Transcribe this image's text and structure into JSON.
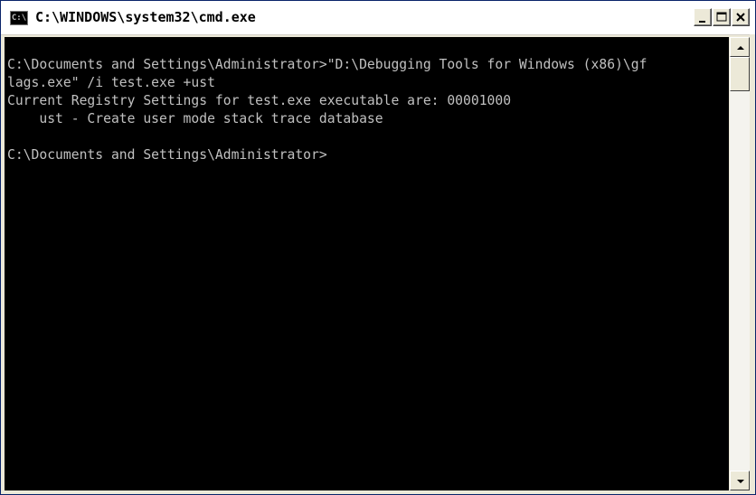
{
  "window": {
    "title": "C:\\WINDOWS\\system32\\cmd.exe",
    "icon_label": "C:\\",
    "icon_name": "cmd-icon"
  },
  "controls": {
    "minimize_icon": "minimize-icon",
    "maximize_icon": "maximize-icon",
    "close_icon": "close-icon"
  },
  "console": {
    "background": "#000000",
    "foreground": "#c0c0c0",
    "lines": [
      "C:\\Documents and Settings\\Administrator>\"D:\\Debugging Tools for Windows (x86)\\gf",
      "lags.exe\" /i test.exe +ust",
      "Current Registry Settings for test.exe executable are: 00001000",
      "    ust - Create user mode stack trace database",
      "",
      "C:\\Documents and Settings\\Administrator>"
    ]
  }
}
